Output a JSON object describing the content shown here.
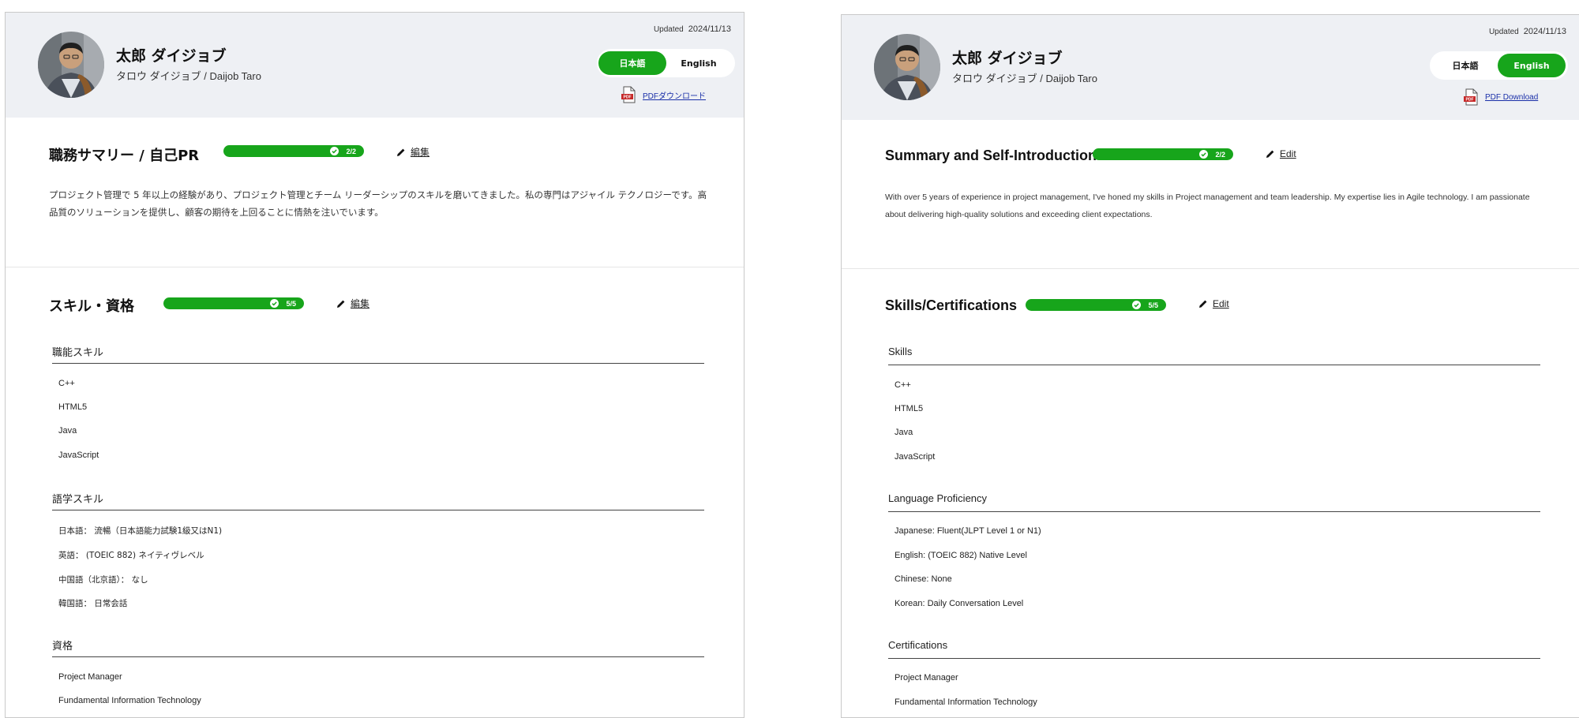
{
  "panels": [
    {
      "updated_label": "Updated",
      "updated_date": "2024/11/13",
      "name": "太郎 ダイジョブ",
      "kana": "タロウ ダイジョブ / Daijob Taro",
      "lang_ja": "日本語",
      "lang_en": "English",
      "active_lang": "ja",
      "pdf_label": "PDFダウンロード",
      "summary": {
        "title": "職務サマリー / 自己PR",
        "progress": "2/2",
        "edit": "編集",
        "text": "プロジェクト管理で 5 年以上の経験があり、プロジェクト管理とチーム リーダーシップのスキルを磨いてきました。私の専門はアジャイル テクノロジーです。高品質のソリューションを提供し、顧客の期待を上回ることに情熱を注いでいます。"
      },
      "skills": {
        "title": "スキル・資格",
        "progress": "5/5",
        "edit": "編集",
        "functional_heading": "職能スキル",
        "functional": [
          "C++",
          "HTML5",
          "Java",
          "JavaScript"
        ],
        "language_heading": "語学スキル",
        "languages": [
          "日本語： 流暢（日本語能力試験1級又はN1)",
          "英語： (TOEIC 882) ネイティヴレベル",
          "中国語（北京語）： なし",
          "韓国語： 日常会話"
        ],
        "cert_heading": "資格",
        "certs": [
          "Project Manager",
          "Fundamental Information Technology"
        ]
      }
    },
    {
      "updated_label": "Updated",
      "updated_date": "2024/11/13",
      "name": "太郎 ダイジョブ",
      "kana": "タロウ ダイジョブ / Daijob Taro",
      "lang_ja": "日本語",
      "lang_en": "English",
      "active_lang": "en",
      "pdf_label": "PDF Download",
      "summary": {
        "title": "Summary and Self-Introduction",
        "progress": "2/2",
        "edit": "Edit",
        "text": "With over 5 years of experience in project management, I've honed my skills in Project management and team leadership. My expertise lies in Agile technology. I am passionate about delivering high-quality solutions and exceeding client expectations."
      },
      "skills": {
        "title": "Skills/Certifications",
        "progress": "5/5",
        "edit": "Edit",
        "functional_heading": "Skills",
        "functional": [
          "C++",
          "HTML5",
          "Java",
          "JavaScript"
        ],
        "language_heading": "Language Proficiency",
        "languages": [
          "Japanese:  Fluent(JLPT Level 1 or N1)",
          "English:  (TOEIC 882)  Native Level",
          "Chinese:  None",
          "Korean:  Daily Conversation Level"
        ],
        "cert_heading": "Certifications",
        "certs": [
          "Project Manager",
          "Fundamental Information Technology"
        ]
      }
    }
  ],
  "colors": {
    "accent": "#17a51b",
    "header_bg": "#eef0f4",
    "link": "#1a2fa8",
    "pdf_red": "#c62828"
  },
  "icons": [
    "avatar-photo",
    "pdf-icon",
    "check-icon",
    "pencil-icon"
  ]
}
